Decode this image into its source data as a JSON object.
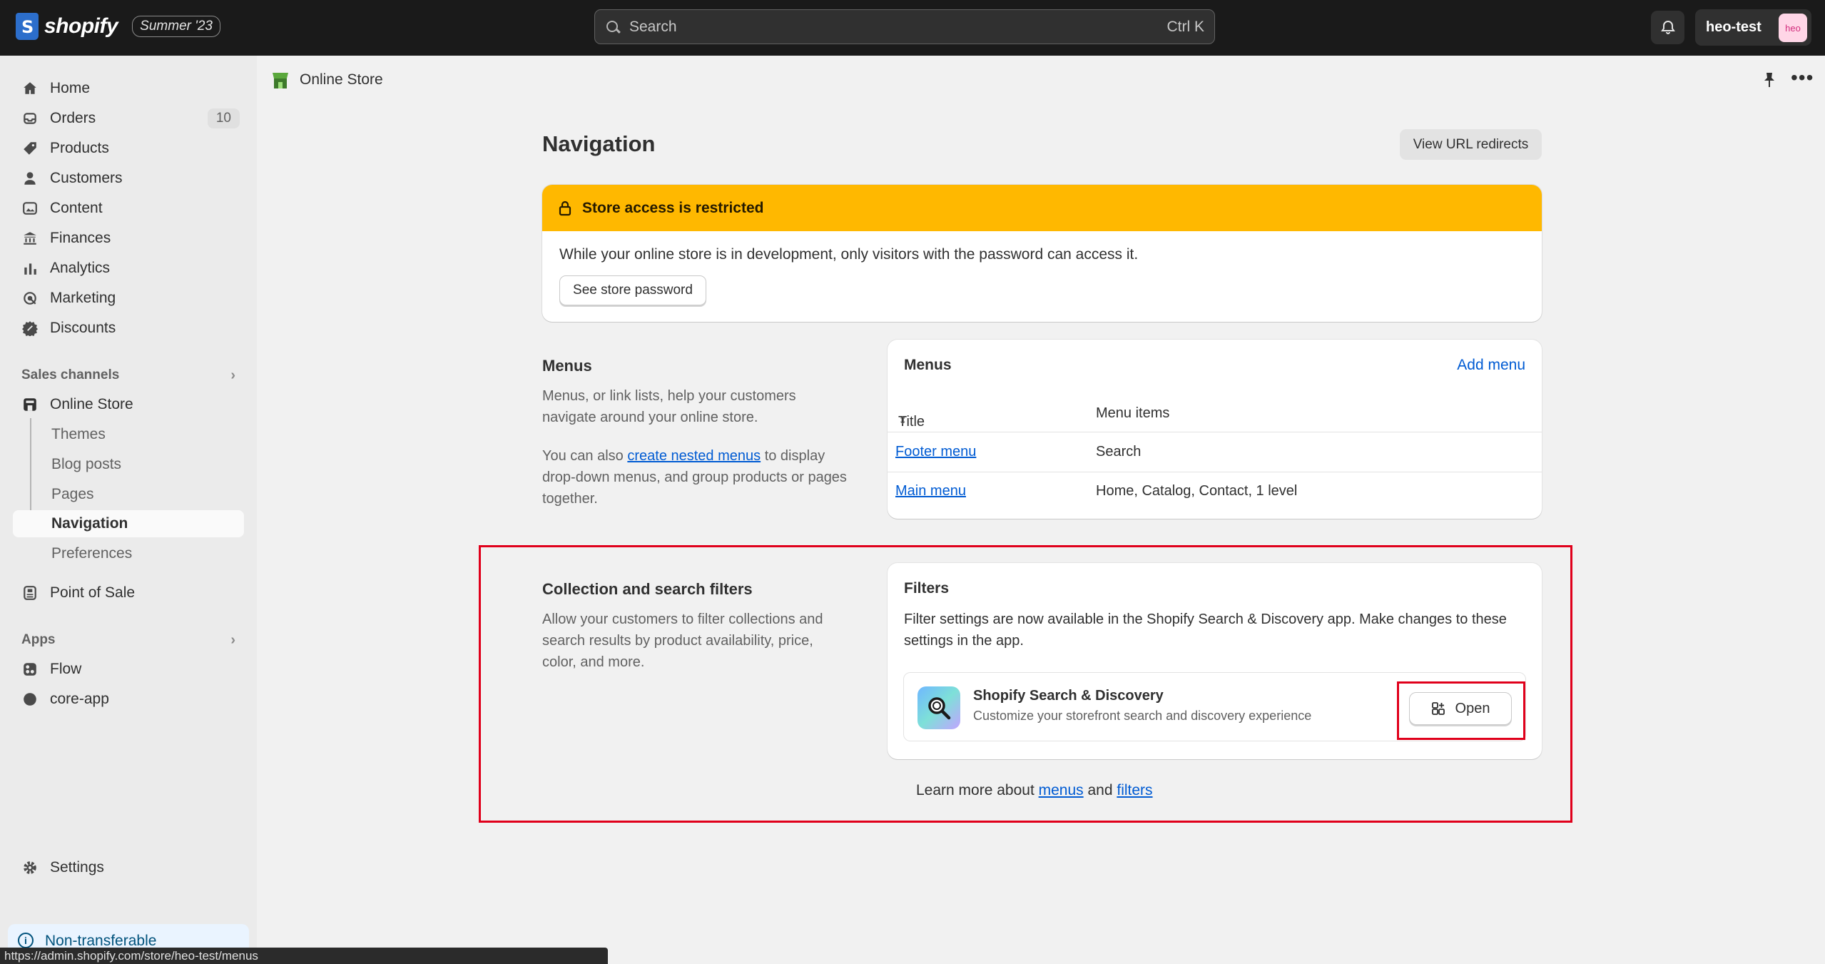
{
  "topbar": {
    "brand": "shopify",
    "edition": "Summer '23",
    "search_placeholder": "Search",
    "search_shortcut": "Ctrl K",
    "store_name": "heo-test",
    "avatar_initials": "heo"
  },
  "sidebar": {
    "items": [
      {
        "label": "Home",
        "icon": "home-icon"
      },
      {
        "label": "Orders",
        "icon": "orders-icon",
        "count": "10"
      },
      {
        "label": "Products",
        "icon": "tag-icon"
      },
      {
        "label": "Customers",
        "icon": "person-icon"
      },
      {
        "label": "Content",
        "icon": "content-icon"
      },
      {
        "label": "Finances",
        "icon": "bank-icon"
      },
      {
        "label": "Analytics",
        "icon": "bar-chart-icon"
      },
      {
        "label": "Marketing",
        "icon": "target-icon"
      },
      {
        "label": "Discounts",
        "icon": "discount-icon"
      }
    ],
    "sales_channels_heading": "Sales channels",
    "online_store": "Online Store",
    "online_store_sub": [
      "Themes",
      "Blog posts",
      "Pages",
      "Navigation",
      "Preferences"
    ],
    "point_of_sale": "Point of Sale",
    "apps_heading": "Apps",
    "apps": [
      "Flow",
      "core-app"
    ],
    "settings": "Settings",
    "non_transferable": "Non-transferable"
  },
  "statusbar_url": "https://admin.shopify.com/store/heo-test/menus",
  "header": {
    "breadcrumb": "Online Store"
  },
  "page": {
    "title": "Navigation",
    "view_redirects": "View URL redirects"
  },
  "banner": {
    "title": "Store access is restricted",
    "text": "While your online store is in development, only visitors with the password can access it.",
    "button": "See store password"
  },
  "menus_section": {
    "title": "Menus",
    "desc1": "Menus, or link lists, help your customers navigate around your online store.",
    "desc2_pre": "You can also ",
    "desc2_link": "create nested menus",
    "desc2_post": " to display drop-down menus, and group products or pages together.",
    "card_title": "Menus",
    "add_menu": "Add menu",
    "col_title": "Title",
    "col_items": "Menu items",
    "rows": [
      {
        "title": "Footer menu",
        "items": "Search"
      },
      {
        "title": "Main menu",
        "items": "Home, Catalog, Contact, 1 level"
      }
    ]
  },
  "filters_section": {
    "title": "Collection and search filters",
    "desc": "Allow your customers to filter collections and search results by product availability, price, color, and more.",
    "card_title": "Filters",
    "card_desc": "Filter settings are now available in the Shopify Search & Discovery app. Make changes to these settings in the app.",
    "app_name": "Shopify Search & Discovery",
    "app_sub": "Customize your storefront search and discovery experience",
    "open_button": "Open"
  },
  "learn_more": {
    "pre": "Learn more about ",
    "menus_link": "menus",
    "mid": " and ",
    "filters_link": "filters"
  },
  "colors": {
    "topbar": "#1a1a1a",
    "banner": "#ffb800",
    "link": "#005bd3",
    "highlight": "#e0001b"
  }
}
